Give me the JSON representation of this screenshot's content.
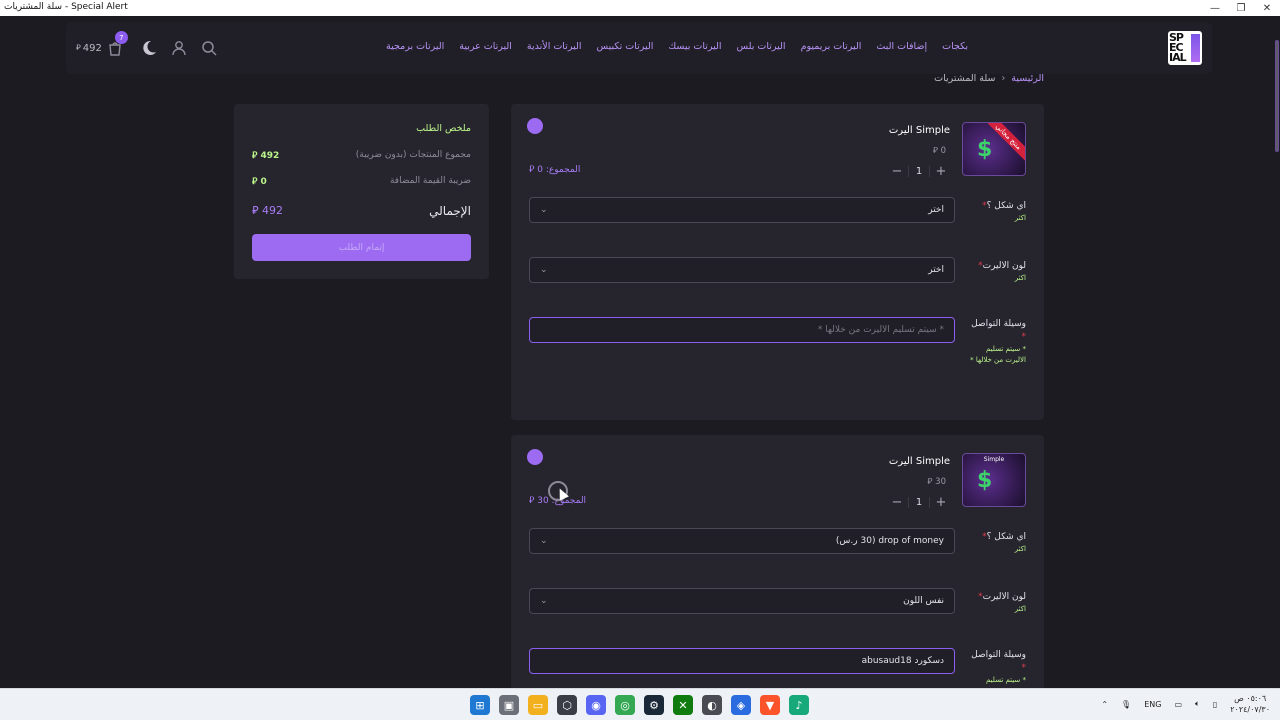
{
  "window": {
    "title": "سلة المشتريات - Special Alert",
    "controls": [
      "—",
      "❐",
      "✕"
    ]
  },
  "nav": {
    "links": [
      "بكجات",
      "إضافات البث",
      "اليرتات بريميوم",
      "اليرتات بلس",
      "اليرتات بيسك",
      "اليرتات تكبيس",
      "اليرتات الأندية",
      "اليرتات عربية",
      "اليرتات برمجية"
    ],
    "cart_amount": "492",
    "cart_badge": "7",
    "currency_symbol": "ر.س"
  },
  "breadcrumb": {
    "home": "الرئيسية",
    "separator": "›",
    "current": "سلة المشتريات"
  },
  "summary": {
    "title": "ملخص الطلب",
    "subtotal_label": "مجموع المنتجات (بدون ضريبة)",
    "subtotal_value": "492",
    "vat_label": "ضريبة القيمة المضافة",
    "vat_value": "0",
    "total_label": "الإجمالي",
    "total_value": "492",
    "checkout_label": "إتمام الطلب"
  },
  "items": [
    {
      "name": "اليرت Simple",
      "price": "0",
      "quantity": "1",
      "subtotal": "المجموع: 0",
      "ribbon": "منتج مجاني",
      "shape_label": "اي شكل ؟",
      "shape_hint": "اكثر",
      "shape_value": "اختر",
      "color_label": "لون الاليرت",
      "color_hint": "اكثر",
      "color_value": "اختر",
      "contact_label": "وسيلة التواصل",
      "contact_hint": "* سيتم تسليم الاليرت من خلالها *",
      "contact_placeholder": "* سيتم تسليم الاليرت من خلالها *",
      "contact_value": ""
    },
    {
      "name": "اليرت Simple",
      "price": "30",
      "quantity": "1",
      "subtotal": "المجموع: 30",
      "thumb_caption": "Simple",
      "shape_label": "اي شكل ؟",
      "shape_hint": "اكثر",
      "shape_value": "drop of money (30 ر.س)",
      "color_label": "لون الاليرت",
      "color_hint": "اكثر",
      "color_value": "نفس اللون",
      "contact_label": "وسيلة التواصل",
      "contact_hint": "* سيتم تسليم",
      "contact_value": "دسكورد abusaud18"
    }
  ],
  "taskbar": {
    "lang": "ENG",
    "time": "٠٥:٠٦ ص",
    "date": "٢٠٢٤/٠٧/٣٠"
  },
  "colors": {
    "accent": "#9c6bf2",
    "green_text": "#bcf58a",
    "bg": "#1c1b22",
    "card": "#26252e"
  }
}
